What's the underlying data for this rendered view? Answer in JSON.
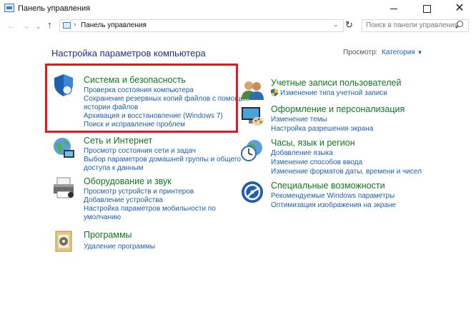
{
  "window": {
    "title": "Панель управления"
  },
  "nav": {
    "address": "Панель управления",
    "search_placeholder": "Поиск в панели управления"
  },
  "main": {
    "heading": "Настройка параметров компьютера",
    "view_by_label": "Просмотр:",
    "view_by_value": "Категория"
  },
  "categories": [
    {
      "title": "Система и безопасность",
      "icon": "shield-icon",
      "links": [
        "Проверка состояния компьютера",
        "Сохранение резервных копий файлов с помощью",
        "истории файлов",
        "Архивация и восстановление (Windows 7)",
        "Поиск и исправление проблем"
      ]
    },
    {
      "title": "Сеть и Интернет",
      "icon": "network-globe-icon",
      "links": [
        "Просмотр состояния сети и задач",
        "Выбор параметров домашней группы и общего",
        "доступа к данным"
      ]
    },
    {
      "title": "Оборудование и звук",
      "icon": "printer-icon",
      "links": [
        "Просмотр устройств и принтеров",
        "Добавление устройства",
        "Настройка параметров мобильности по",
        "умолчанию"
      ]
    },
    {
      "title": "Программы",
      "icon": "programs-icon",
      "links": [
        "Удаление программы"
      ]
    },
    {
      "title": "Учетные записи пользователей",
      "icon": "users-icon",
      "links": [
        "Изменение типа учетной записи"
      ]
    },
    {
      "title": "Оформление и персонализация",
      "icon": "monitor-palette-icon",
      "links": [
        "Изменение темы",
        "Настройка разрешения экрана"
      ]
    },
    {
      "title": "Часы, язык и регион",
      "icon": "clock-globe-icon",
      "links": [
        "Добавление языка",
        "Изменение способов ввода",
        "Изменение форматов даты, времени и чисел"
      ]
    },
    {
      "title": "Специальные возможности",
      "icon": "accessibility-icon",
      "links": [
        "Рекомендуемые Windows параметры",
        "Оптимизация изображения на экране"
      ]
    }
  ],
  "colors": {
    "category_title": "#0d7a1f",
    "link": "#1a5fb4",
    "heading": "#1e3287",
    "highlight_box": "#e4191f"
  }
}
